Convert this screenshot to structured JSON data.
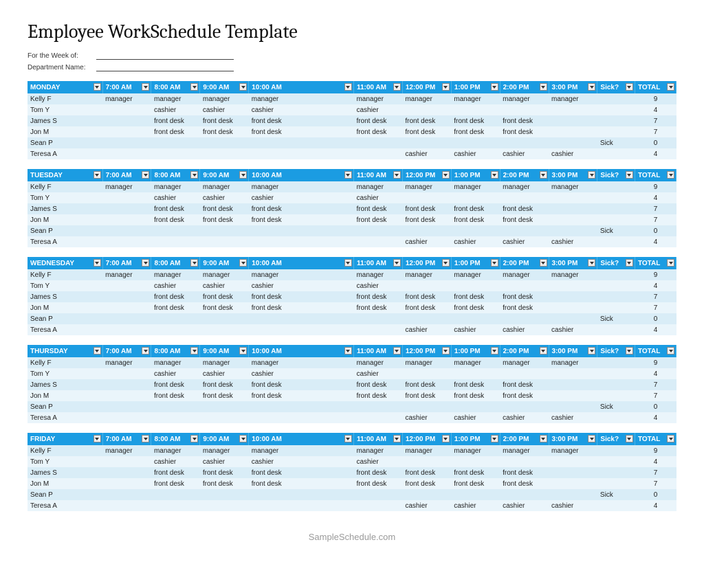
{
  "title": "Employee WorkSchedule Template",
  "meta": {
    "week_label": "For the Week of:",
    "dept_label": "Department Name:"
  },
  "columns": [
    "7:00 AM",
    "8:00 AM",
    "9:00 AM",
    "10:00 AM",
    "11:00 AM",
    "12:00 PM",
    "1:00 PM",
    "2:00 PM",
    "3:00 PM",
    "Sick?",
    "TOTAL"
  ],
  "days": [
    {
      "name": "MONDAY",
      "rows": [
        {
          "emp": "Kelly F",
          "cells": [
            "manager",
            "manager",
            "manager",
            "manager",
            "manager",
            "manager",
            "manager",
            "manager",
            "manager",
            "",
            "9"
          ]
        },
        {
          "emp": "Tom Y",
          "cells": [
            "",
            "cashier",
            "cashier",
            "cashier",
            "cashier",
            "",
            "",
            "",
            "",
            "",
            "4"
          ]
        },
        {
          "emp": "James S",
          "cells": [
            "",
            "front desk",
            "front desk",
            "front desk",
            "front desk",
            "front desk",
            "front desk",
            "front desk",
            "",
            "",
            "7"
          ]
        },
        {
          "emp": "Jon M",
          "cells": [
            "",
            "front desk",
            "front desk",
            "front desk",
            "front desk",
            "front desk",
            "front desk",
            "front desk",
            "",
            "",
            "7"
          ]
        },
        {
          "emp": "Sean P",
          "cells": [
            "",
            "",
            "",
            "",
            "",
            "",
            "",
            "",
            "",
            "Sick",
            "0"
          ]
        },
        {
          "emp": "Teresa A",
          "cells": [
            "",
            "",
            "",
            "",
            "",
            "cashier",
            "cashier",
            "cashier",
            "cashier",
            "",
            "4"
          ]
        }
      ]
    },
    {
      "name": "TUESDAY",
      "rows": [
        {
          "emp": "Kelly F",
          "cells": [
            "manager",
            "manager",
            "manager",
            "manager",
            "manager",
            "manager",
            "manager",
            "manager",
            "manager",
            "",
            "9"
          ]
        },
        {
          "emp": "Tom Y",
          "cells": [
            "",
            "cashier",
            "cashier",
            "cashier",
            "cashier",
            "",
            "",
            "",
            "",
            "",
            "4"
          ]
        },
        {
          "emp": "James S",
          "cells": [
            "",
            "front desk",
            "front desk",
            "front desk",
            "front desk",
            "front desk",
            "front desk",
            "front desk",
            "",
            "",
            "7"
          ]
        },
        {
          "emp": "Jon M",
          "cells": [
            "",
            "front desk",
            "front desk",
            "front desk",
            "front desk",
            "front desk",
            "front desk",
            "front desk",
            "",
            "",
            "7"
          ]
        },
        {
          "emp": "Sean P",
          "cells": [
            "",
            "",
            "",
            "",
            "",
            "",
            "",
            "",
            "",
            "Sick",
            "0"
          ]
        },
        {
          "emp": "Teresa A",
          "cells": [
            "",
            "",
            "",
            "",
            "",
            "cashier",
            "cashier",
            "cashier",
            "cashier",
            "",
            "4"
          ]
        }
      ]
    },
    {
      "name": "WEDNESDAY",
      "rows": [
        {
          "emp": "Kelly F",
          "cells": [
            "manager",
            "manager",
            "manager",
            "manager",
            "manager",
            "manager",
            "manager",
            "manager",
            "manager",
            "",
            "9"
          ]
        },
        {
          "emp": "Tom Y",
          "cells": [
            "",
            "cashier",
            "cashier",
            "cashier",
            "cashier",
            "",
            "",
            "",
            "",
            "",
            "4"
          ]
        },
        {
          "emp": "James S",
          "cells": [
            "",
            "front desk",
            "front desk",
            "front desk",
            "front desk",
            "front desk",
            "front desk",
            "front desk",
            "",
            "",
            "7"
          ]
        },
        {
          "emp": "Jon M",
          "cells": [
            "",
            "front desk",
            "front desk",
            "front desk",
            "front desk",
            "front desk",
            "front desk",
            "front desk",
            "",
            "",
            "7"
          ]
        },
        {
          "emp": "Sean P",
          "cells": [
            "",
            "",
            "",
            "",
            "",
            "",
            "",
            "",
            "",
            "Sick",
            "0"
          ]
        },
        {
          "emp": "Teresa A",
          "cells": [
            "",
            "",
            "",
            "",
            "",
            "cashier",
            "cashier",
            "cashier",
            "cashier",
            "",
            "4"
          ]
        }
      ]
    },
    {
      "name": "THURSDAY",
      "rows": [
        {
          "emp": "Kelly F",
          "cells": [
            "manager",
            "manager",
            "manager",
            "manager",
            "manager",
            "manager",
            "manager",
            "manager",
            "manager",
            "",
            "9"
          ]
        },
        {
          "emp": "Tom Y",
          "cells": [
            "",
            "cashier",
            "cashier",
            "cashier",
            "cashier",
            "",
            "",
            "",
            "",
            "",
            "4"
          ]
        },
        {
          "emp": "James S",
          "cells": [
            "",
            "front desk",
            "front desk",
            "front desk",
            "front desk",
            "front desk",
            "front desk",
            "front desk",
            "",
            "",
            "7"
          ]
        },
        {
          "emp": "Jon M",
          "cells": [
            "",
            "front desk",
            "front desk",
            "front desk",
            "front desk",
            "front desk",
            "front desk",
            "front desk",
            "",
            "",
            "7"
          ]
        },
        {
          "emp": "Sean P",
          "cells": [
            "",
            "",
            "",
            "",
            "",
            "",
            "",
            "",
            "",
            "Sick",
            "0"
          ]
        },
        {
          "emp": "Teresa A",
          "cells": [
            "",
            "",
            "",
            "",
            "",
            "cashier",
            "cashier",
            "cashier",
            "cashier",
            "",
            "4"
          ]
        }
      ]
    },
    {
      "name": "FRIDAY",
      "rows": [
        {
          "emp": "Kelly F",
          "cells": [
            "manager",
            "manager",
            "manager",
            "manager",
            "manager",
            "manager",
            "manager",
            "manager",
            "manager",
            "",
            "9"
          ]
        },
        {
          "emp": "Tom Y",
          "cells": [
            "",
            "cashier",
            "cashier",
            "cashier",
            "cashier",
            "",
            "",
            "",
            "",
            "",
            "4"
          ]
        },
        {
          "emp": "James S",
          "cells": [
            "",
            "front desk",
            "front desk",
            "front desk",
            "front desk",
            "front desk",
            "front desk",
            "front desk",
            "",
            "",
            "7"
          ]
        },
        {
          "emp": "Jon M",
          "cells": [
            "",
            "front desk",
            "front desk",
            "front desk",
            "front desk",
            "front desk",
            "front desk",
            "front desk",
            "",
            "",
            "7"
          ]
        },
        {
          "emp": "Sean P",
          "cells": [
            "",
            "",
            "",
            "",
            "",
            "",
            "",
            "",
            "",
            "Sick",
            "0"
          ]
        },
        {
          "emp": "Teresa A",
          "cells": [
            "",
            "",
            "",
            "",
            "",
            "cashier",
            "cashier",
            "cashier",
            "cashier",
            "",
            "4"
          ]
        }
      ]
    }
  ],
  "footer": "SampleSchedule.com"
}
